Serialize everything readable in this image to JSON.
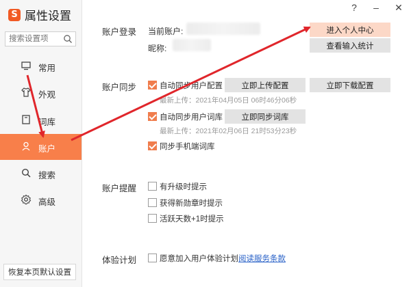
{
  "app": {
    "title": "属性设置",
    "logo_letter": "S",
    "accent": "#f87f4a"
  },
  "window_controls": {
    "help": "?",
    "minimize": "–",
    "close": "✕"
  },
  "search": {
    "placeholder": "搜索设置项",
    "icon": "search-icon"
  },
  "sidebar": {
    "items": [
      {
        "label": "常用",
        "icon": "monitor-icon",
        "active": false
      },
      {
        "label": "外观",
        "icon": "shirt-icon",
        "active": false
      },
      {
        "label": "词库",
        "icon": "book-icon",
        "active": false
      },
      {
        "label": "账户",
        "icon": "user-icon",
        "active": true
      },
      {
        "label": "搜索",
        "icon": "search-icon",
        "active": false
      },
      {
        "label": "高级",
        "icon": "gear-icon",
        "active": false
      }
    ],
    "restore_label": "恢复本页默认设置"
  },
  "account_login": {
    "title": "账户登录",
    "current_account_label": "当前账户:",
    "nickname_label": "昵称:",
    "enter_center_label": "进入个人中心",
    "view_stats_label": "查看输入统计"
  },
  "account_sync": {
    "title": "账户同步",
    "auto_sync_config_label": "自动同步用户配置",
    "upload_config_label": "立即上传配置",
    "download_config_label": "立即下载配置",
    "config_last_upload": "最新上传：2021年04月05日 06时46分06秒",
    "auto_sync_dict_label": "自动同步用户词库",
    "sync_dict_label": "立即同步词库",
    "dict_last_upload": "最新上传：2021年02月06日 21时53分23秒",
    "sync_mobile_dict_label": "同步手机端词库"
  },
  "account_reminder": {
    "title": "账户提醒",
    "options": [
      "有升级时提示",
      "获得新勋章时提示",
      "活跃天数+1时提示"
    ]
  },
  "experience_plan": {
    "title": "体验计划",
    "join_label": "愿意加入用户体验计划",
    "terms_link": "阅读服务条款"
  }
}
